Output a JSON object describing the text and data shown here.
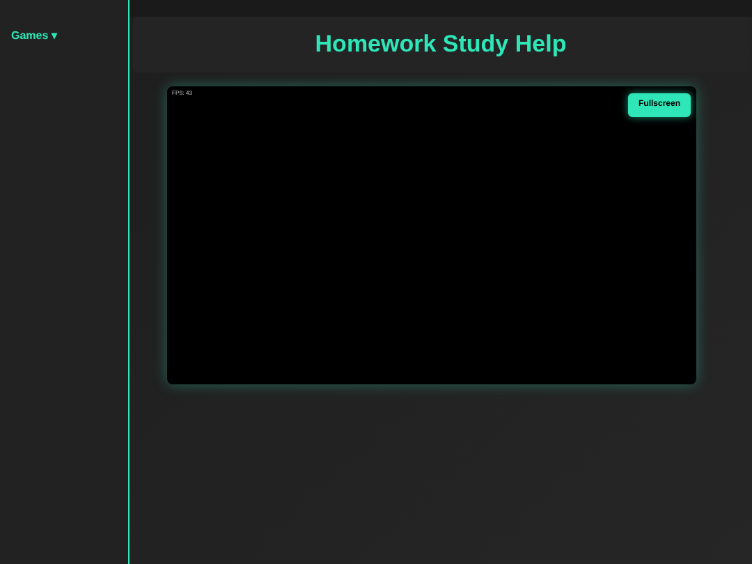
{
  "sidebar": {
    "menu": {
      "label": "Games ▾"
    }
  },
  "header": {
    "title": "Homework Study Help"
  },
  "game": {
    "fps": "FPS: 43",
    "fullscreen_button": "Fullscreen"
  }
}
